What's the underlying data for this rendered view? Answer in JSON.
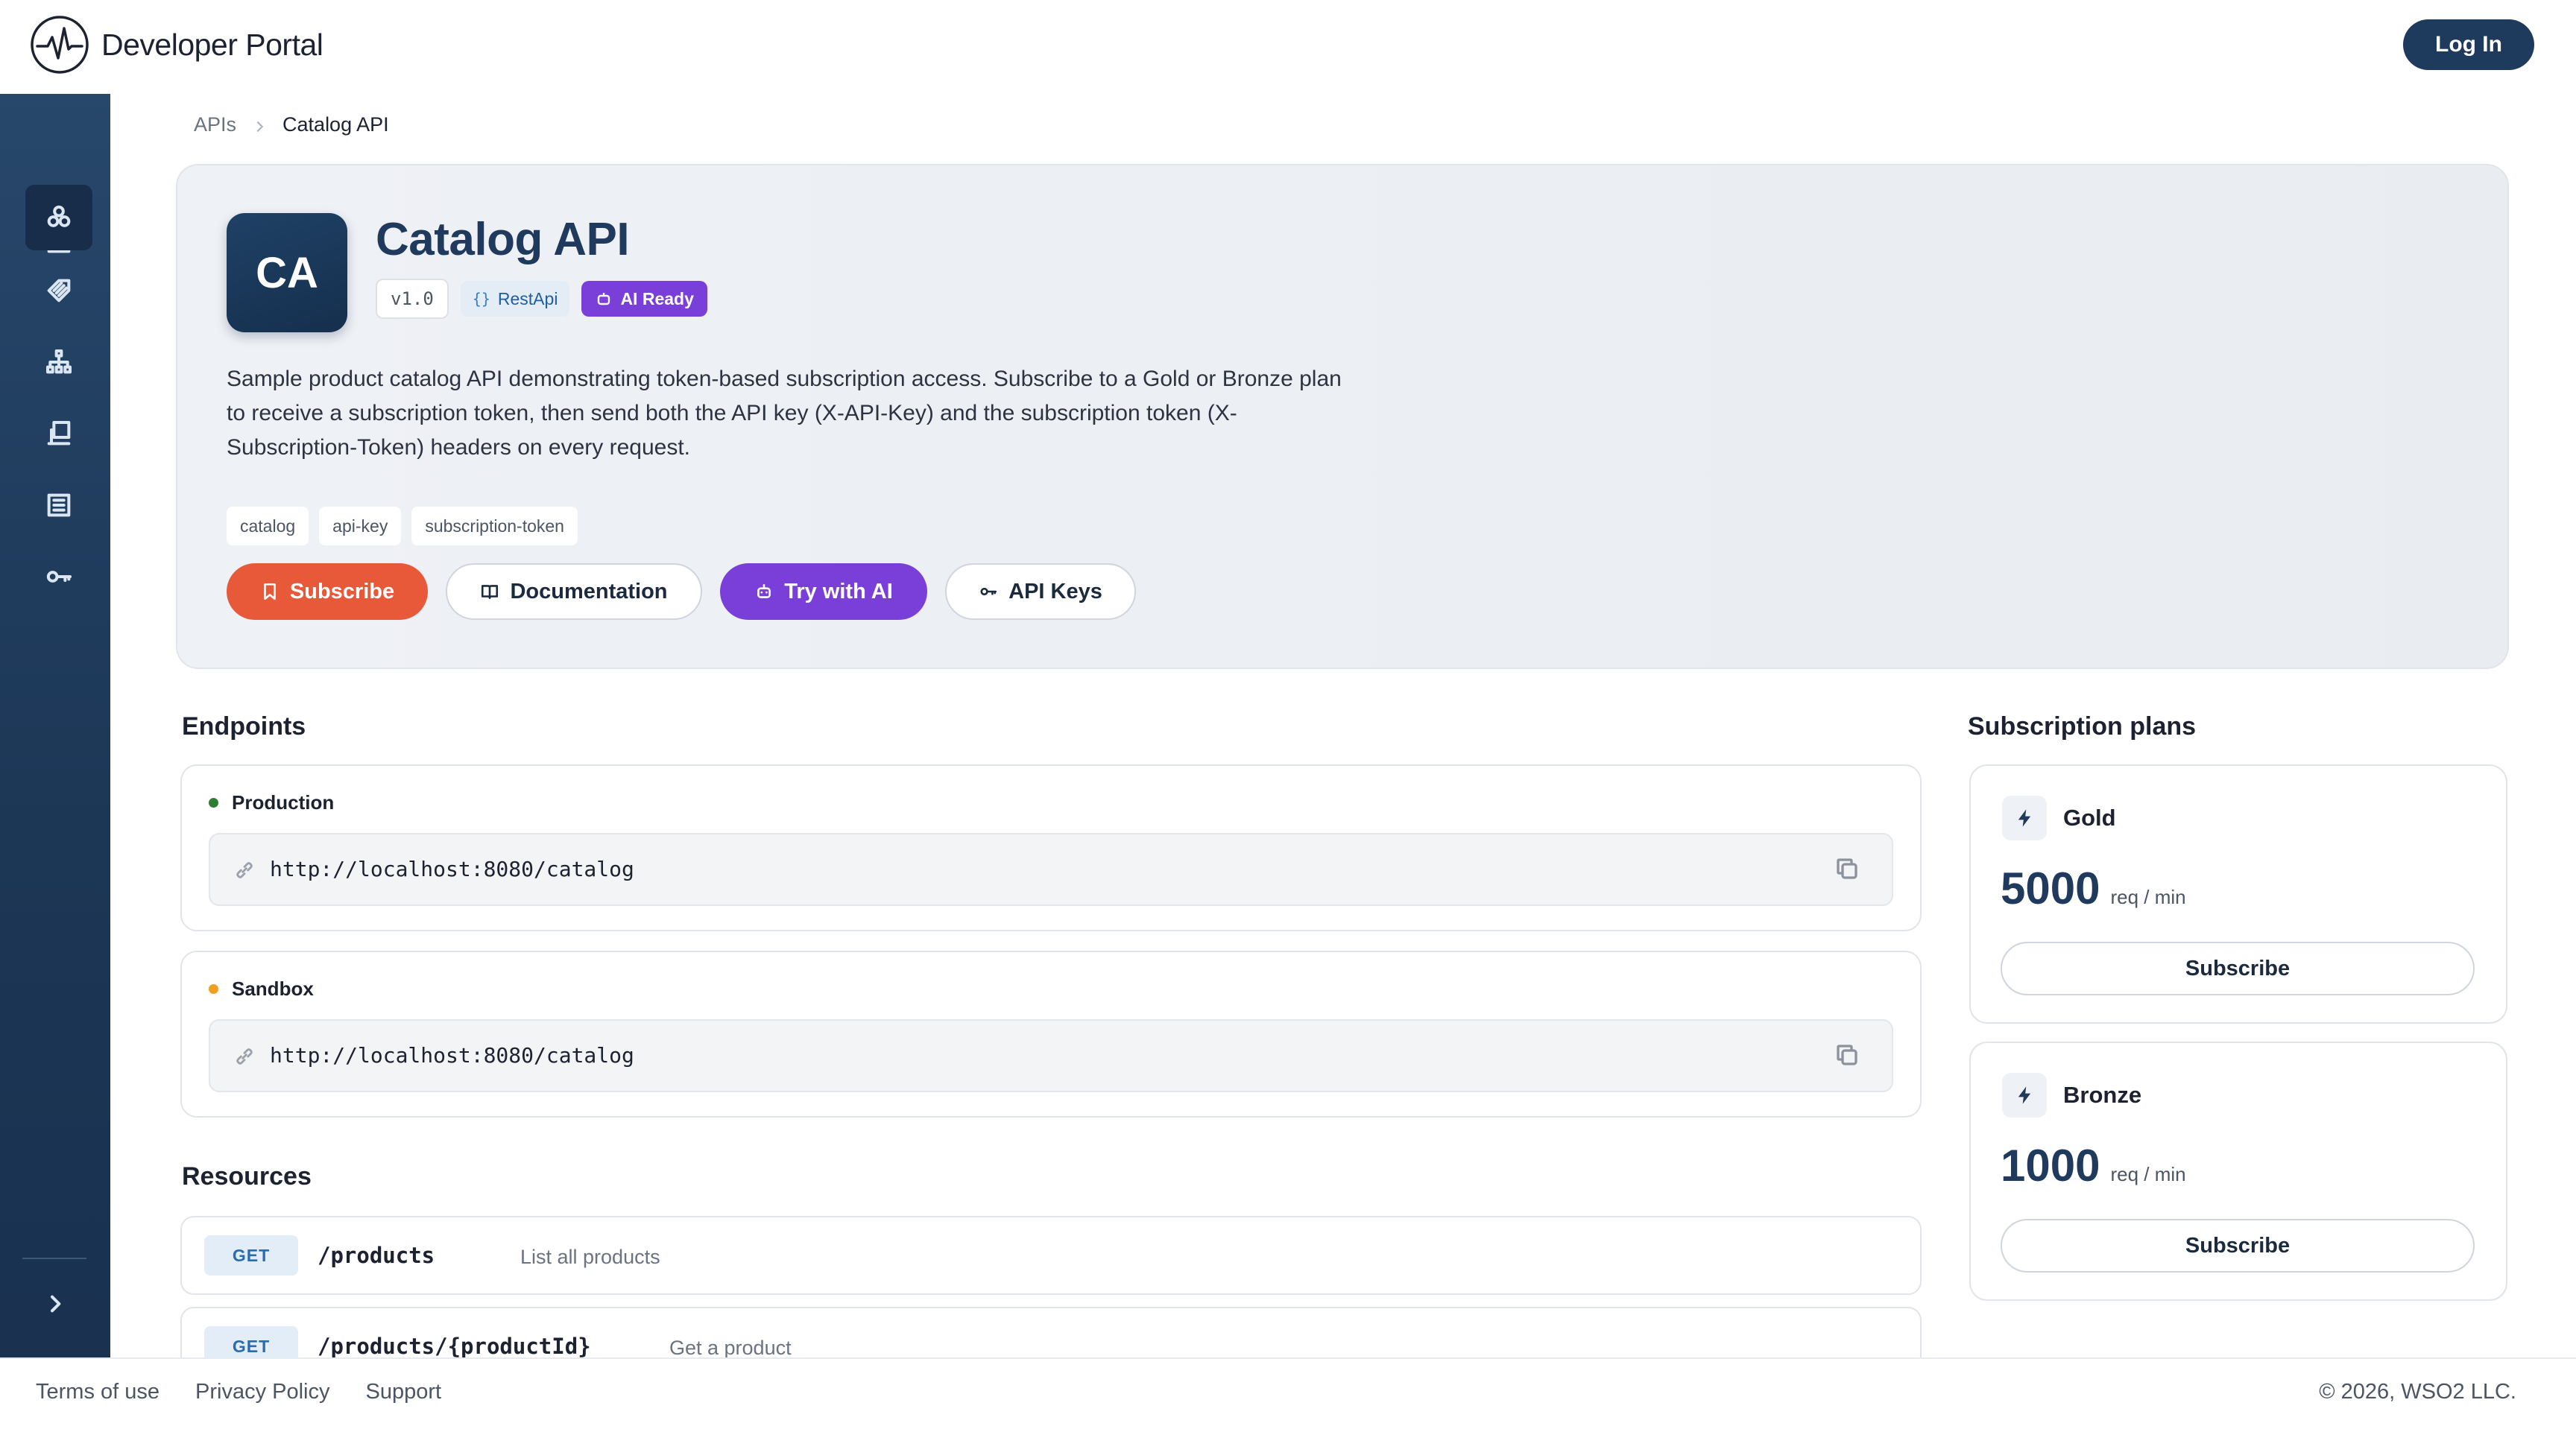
{
  "header": {
    "brand_name": "Developer Portal",
    "login_label": "Log In"
  },
  "sidebar": {
    "items": [
      {
        "name": "home-icon"
      },
      {
        "name": "apis-icon",
        "active": true
      },
      {
        "name": "tag-icon"
      },
      {
        "name": "org-chart-icon"
      },
      {
        "name": "applications-icon"
      },
      {
        "name": "docs-icon"
      },
      {
        "name": "key-icon"
      }
    ],
    "collapse_icon": "chevron-right-icon"
  },
  "breadcrumb": {
    "parent": "APIs",
    "current": "Catalog API"
  },
  "api": {
    "avatar_initials": "CA",
    "title": "Catalog API",
    "version": "v1.0",
    "type": "RestApi",
    "ai_badge": "AI Ready",
    "description": "Sample product catalog API demonstrating token-based subscription access. Subscribe to a Gold or Bronze plan to receive a subscription token, then send both the API key (X-API-Key) and the subscription token (X-Subscription-Token) headers on every request.",
    "tags": [
      "catalog",
      "api-key",
      "subscription-token"
    ],
    "actions": {
      "subscribe": "Subscribe",
      "documentation": "Documentation",
      "try_ai": "Try with AI",
      "api_keys": "API Keys"
    }
  },
  "endpoints": {
    "title": "Endpoints",
    "items": [
      {
        "env": "Production",
        "url": "http://localhost:8080/catalog",
        "dot_color": "#2e7d32"
      },
      {
        "env": "Sandbox",
        "url": "http://localhost:8080/catalog",
        "dot_color": "#f0a020"
      }
    ]
  },
  "resources": {
    "title": "Resources",
    "items": [
      {
        "method": "GET",
        "path": "/products",
        "description": "List all products"
      },
      {
        "method": "GET",
        "path": "/products/{productId}",
        "description": "Get a product"
      }
    ]
  },
  "plans": {
    "title": "Subscription plans",
    "items": [
      {
        "name": "Gold",
        "rate": "5000",
        "unit": "req / min",
        "button": "Subscribe"
      },
      {
        "name": "Bronze",
        "rate": "1000",
        "unit": "req / min",
        "button": "Subscribe"
      }
    ]
  },
  "footer": {
    "links": [
      "Terms of use",
      "Privacy Policy",
      "Support"
    ],
    "copyright": "© 2026, WSO2 LLC."
  },
  "colors": {
    "primary": "#1e3a5c",
    "accent_orange": "#e8593a",
    "accent_purple": "#7b3fd9"
  }
}
